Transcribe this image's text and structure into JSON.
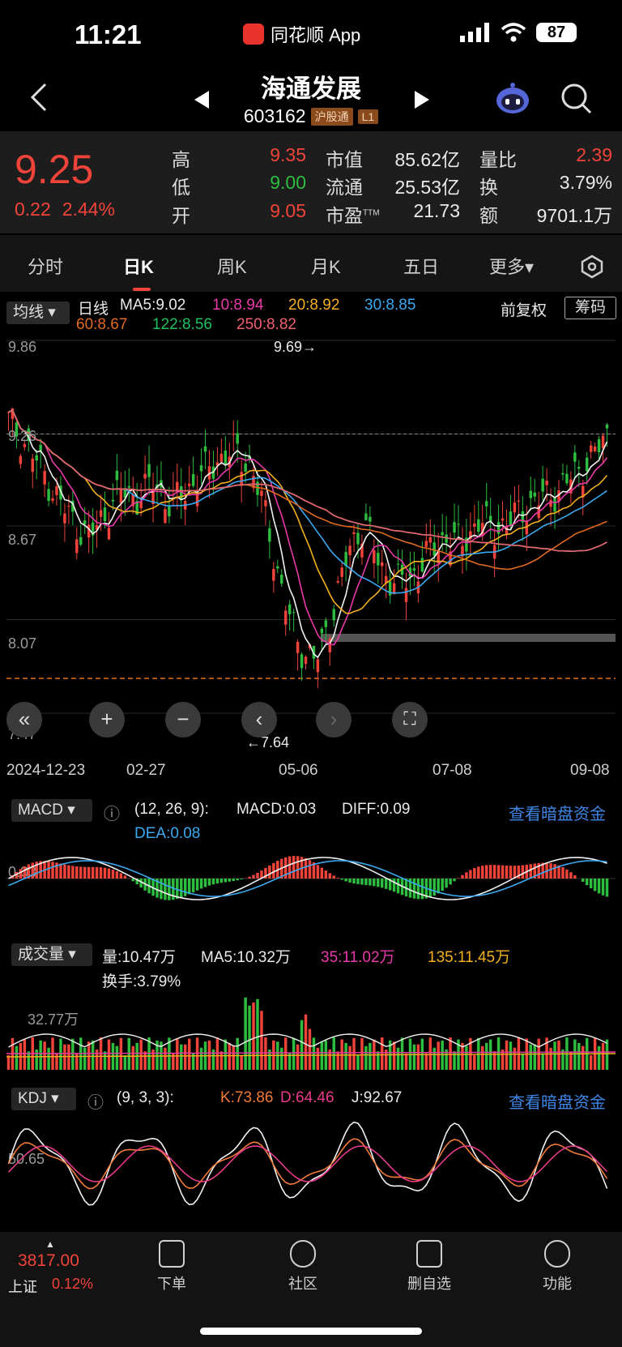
{
  "status_bar": {
    "time": "11:21",
    "app_label": "同花顺 App",
    "battery": "87"
  },
  "header": {
    "title": "海通发展",
    "code": "603162",
    "tag_exchange": "沪股通",
    "tag_level": "L1"
  },
  "quote": {
    "price": "9.25",
    "change": "0.22",
    "change_pct": "2.44%",
    "high_label": "高",
    "high": "9.35",
    "low_label": "低",
    "low": "9.00",
    "open_label": "开",
    "open": "9.05",
    "mktcap_label": "市值",
    "mktcap": "85.62亿",
    "float_label": "流通",
    "float": "25.53亿",
    "pe_label": "市盈",
    "pe_sup": "TTM",
    "pe": "21.73",
    "volratio_label": "量比",
    "volratio": "2.39",
    "turnover_label": "换",
    "turnover": "3.79%",
    "amount_label": "额",
    "amount": "9701.1万"
  },
  "tabs": [
    "分时",
    "日K",
    "周K",
    "月K",
    "五日",
    "更多▾"
  ],
  "ma_bar": {
    "button": "均线",
    "label": "日线",
    "ma5": "MA5:9.02",
    "ma10": "10:8.94",
    "ma20": "20:8.92",
    "ma30": "30:8.85",
    "ma60": "60:8.67",
    "ma122": "122:8.56",
    "ma250": "250:8.82",
    "adjust": "前复权",
    "chips": "筹码"
  },
  "colors": {
    "ma5": "#f2f2f2",
    "ma10": "#e83aa8",
    "ma20": "#f2b01e",
    "ma30": "#3ba8f0",
    "ma60": "#e06a20",
    "ma122": "#20c060",
    "ma250": "#f06070",
    "up": "#f0443a",
    "down": "#2dbd3f"
  },
  "chart": {
    "y_top": "9.86",
    "y_mid1": "9.26",
    "y_mid2": "8.67",
    "y_mid3": "8.07",
    "y_bottom": "7.47",
    "high_mark": "9.69→",
    "low_mark": "←7.64",
    "dates": [
      "2024-12-23",
      "02-27",
      "05-06",
      "07-08",
      "09-08"
    ]
  },
  "chart_data": {
    "type": "candlestick",
    "ylim": [
      7.47,
      9.86
    ],
    "y_ticks": [
      9.86,
      9.26,
      8.67,
      8.07,
      7.47
    ],
    "x_ticks": [
      "2024-12-23",
      "02-27",
      "05-06",
      "07-08",
      "09-08"
    ],
    "period_high": 9.69,
    "period_low": 7.64,
    "close": [
      9.35,
      9.2,
      9.05,
      8.85,
      8.7,
      8.6,
      8.75,
      8.9,
      8.85,
      8.95,
      8.8,
      8.9,
      9.0,
      9.1,
      9.15,
      9.05,
      8.7,
      8.2,
      7.9,
      7.8,
      8.1,
      8.5,
      8.7,
      8.4,
      8.3,
      8.35,
      8.5,
      8.6,
      8.55,
      8.7,
      8.65,
      8.7,
      8.8,
      8.85,
      8.9,
      9.0,
      9.1,
      9.25
    ]
  },
  "macd": {
    "button": "MACD",
    "params": "(12, 26, 9):",
    "macd": "MACD:0.03",
    "diff": "DIFF:0.09",
    "dea": "DEA:0.08",
    "axis": "0.03",
    "link": "查看暗盘资金"
  },
  "volume": {
    "button": "成交量",
    "vol": "量:10.47万",
    "ma5": "MA5:10.32万",
    "ma35": "35:11.02万",
    "ma135": "135:11.45万",
    "turnover": "换手:3.79%",
    "axis": "32.77万"
  },
  "kdj": {
    "button": "KDJ",
    "params": "(9, 3, 3):",
    "k": "K:73.86",
    "d": "D:64.46",
    "j": "J:92.67",
    "axis": "50.65",
    "link": "查看暗盘资金"
  },
  "bottom_nav": {
    "index_value": "3817.00",
    "index_name": "上证",
    "index_pct": "0.12%",
    "items": [
      "下单",
      "社区",
      "删自选",
      "功能"
    ]
  }
}
